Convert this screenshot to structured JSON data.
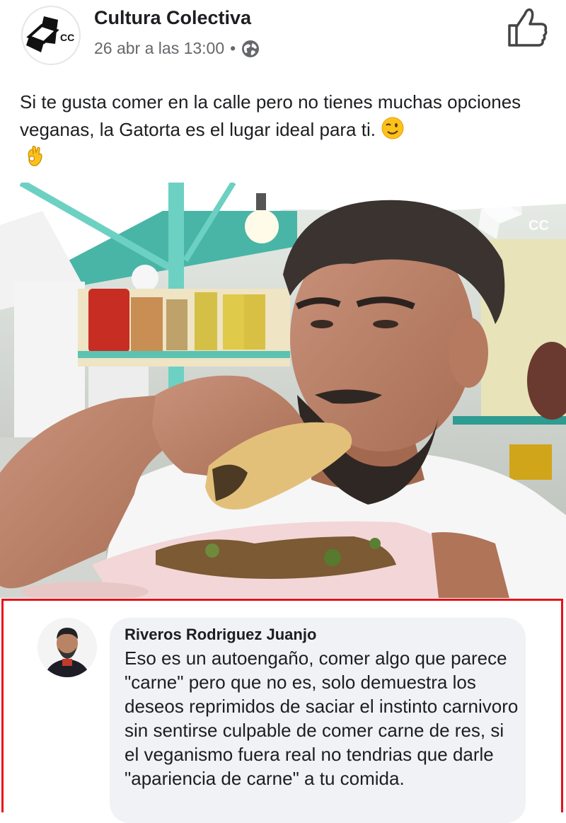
{
  "post": {
    "page_name": "Cultura Colectiva",
    "logo_text": "CC",
    "timestamp": "26 abr a las 13:00",
    "separator": "•",
    "privacy_icon": "globe-icon",
    "like_icon": "thumbs-up-icon",
    "text": "Si te gusta comer en la calle pero no tienes muchas opciones veganas, la Gatorta es el lugar ideal para ti.",
    "emojis": [
      "wink-emoji",
      "ok-hand-emoji"
    ]
  },
  "photo": {
    "watermark": "CC",
    "description_icon": "video-still-image"
  },
  "comment": {
    "author": "Riveros Rodriguez Juanjo",
    "text": "Eso es un autoengaño, comer algo que parece \"carne\" pero que no es, solo demuestra los deseos reprimidos de saciar el instinto carnivoro sin sentirse culpable de comer carne de res, si el veganismo fuera real no tendrias que darle \"apariencia de carne\" a tu comida.",
    "highlight_color": "#e8101a"
  },
  "colors": {
    "text": "#1c1e21",
    "meta": "#65676b",
    "bubble": "#f0f2f5",
    "awning": "#4fbfb0"
  }
}
